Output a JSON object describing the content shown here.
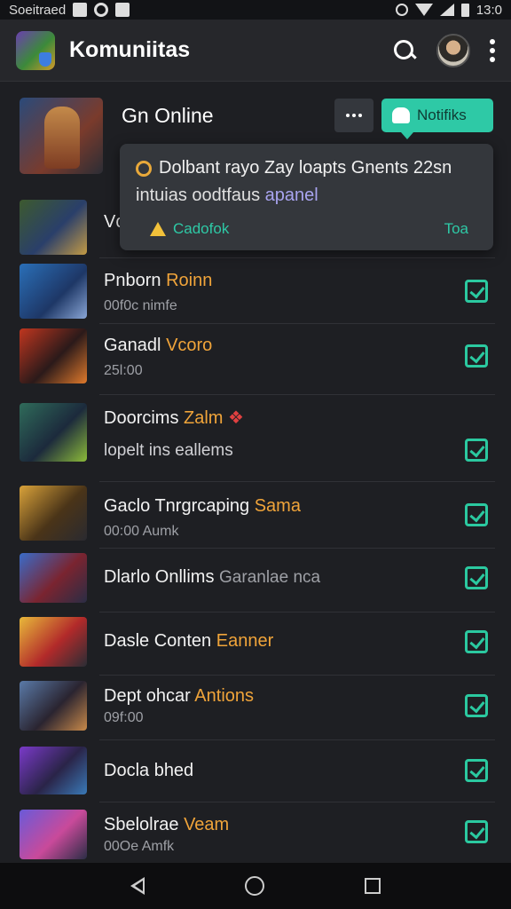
{
  "status_bar": {
    "carrier": "Soeitraed",
    "time": "13:0"
  },
  "app_bar": {
    "title": "Komuniitas"
  },
  "hero": {
    "title": "Gn Online",
    "notify_label": "Notifiks"
  },
  "popup": {
    "line1": "Dolbant rayo Zay loapts Gnents 22sn",
    "line2_prefix": "intuias oodtfaus ",
    "line2_link": "apanel",
    "warn_label": "Cadofok",
    "action": "Toa"
  },
  "rows": [
    {
      "title": "Vc",
      "accent": "",
      "sub": ""
    },
    {
      "title": "Pnborn ",
      "accent": "Roinn",
      "sub": "00f0c nimfe"
    },
    {
      "title": "Ganadl ",
      "accent": "Vcoro",
      "sub": "25l:00"
    },
    {
      "title": "Doorcims ",
      "accent": "Zalm",
      "sub": "lopelt ins eallems"
    },
    {
      "title": "Gaclo Tnrgrcaping ",
      "accent": "Sama",
      "sub": "00:00 Aumk"
    },
    {
      "title": "Dlarlo Onllims ",
      "accent": "",
      "sub_inline": "Garanlae nca",
      "sub": ""
    },
    {
      "title": "Dasle Conten ",
      "accent": "Eanner",
      "sub": ""
    },
    {
      "title": "Dept ohcar ",
      "accent": "Antions",
      "sub": "09f:00"
    },
    {
      "title": "Docla bhed",
      "accent": "",
      "sub": ""
    },
    {
      "title": "Sbelolrae ",
      "accent": "Veam",
      "sub": "00Oe Amfk"
    }
  ]
}
